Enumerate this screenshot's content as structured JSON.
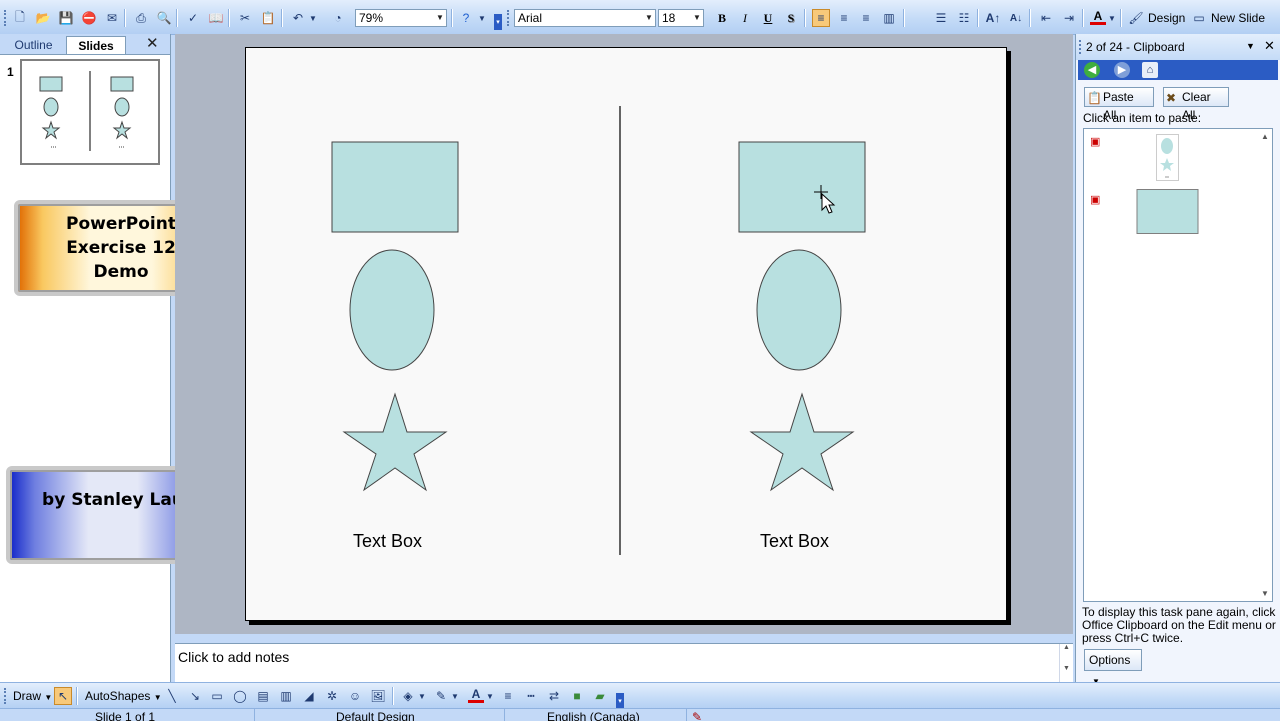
{
  "toolbar": {
    "zoom": "79%",
    "font_name": "Arial",
    "font_size": "18",
    "bold": "B",
    "italic": "I",
    "underline": "U",
    "shadow": "S",
    "design_label": "Design",
    "new_slide_label": "New Slide",
    "font_color_letter": "A"
  },
  "left_pane": {
    "tab_outline": "Outline",
    "tab_slides": "Slides",
    "close": "✕",
    "slide_number": "1"
  },
  "badges": {
    "title": "PowerPoint Exercise 12 Demo",
    "author": "by Stanley Lau"
  },
  "slide": {
    "left_text": "Text Box",
    "right_text": "Text Box",
    "shape_fill": "#b8e0e0",
    "shape_stroke": "#444444"
  },
  "notes": {
    "placeholder": "Click to add notes"
  },
  "task_pane": {
    "title": "2 of 24 - Clipboard",
    "paste_all": "Paste All",
    "clear_all": "Clear All",
    "instruction": "Click an item to paste:",
    "help_text": "To display this task pane again, click Office Clipboard on the Edit menu or press Ctrl+C twice.",
    "options": "Options"
  },
  "draw_toolbar": {
    "draw": "Draw",
    "autoshapes": "AutoShapes"
  },
  "status_bar": {
    "slide_position": "Slide 1 of 1",
    "design": "Default Design",
    "language": "English (Canada)"
  }
}
